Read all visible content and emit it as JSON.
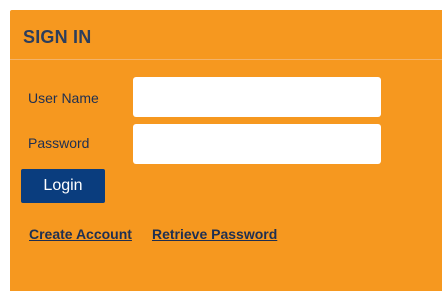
{
  "signin": {
    "title": "SIGN IN",
    "username_label": "User Name",
    "password_label": "Password",
    "username_value": "",
    "password_value": "",
    "login_label": "Login",
    "create_account_label": "Create Account",
    "retrieve_password_label": "Retrieve Password"
  },
  "colors": {
    "panel_background": "#f6981f",
    "login_button": "#0a3d7e",
    "text_dark": "#1e2f52"
  }
}
